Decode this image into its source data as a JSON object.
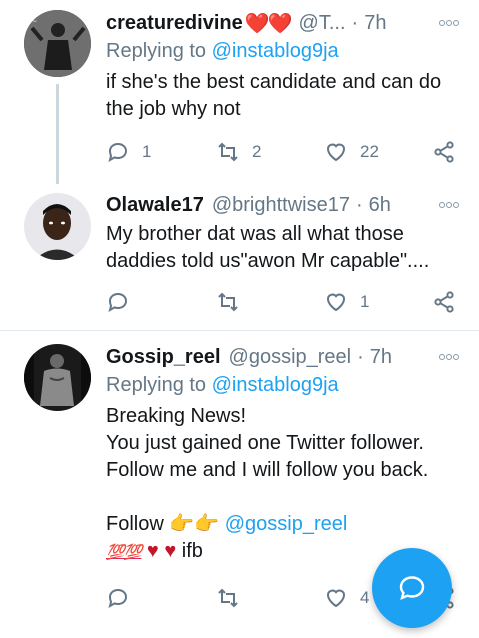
{
  "tweets": [
    {
      "name": "creaturedivine",
      "name_emoji": "❤️❤️",
      "handle": "@T...",
      "time": "7h",
      "replying_prefix": "Replying to",
      "replying_to": "@instablog9ja",
      "lines": [
        "if she's the best candidate and can do",
        "the job why not"
      ],
      "replies": "1",
      "retweets": "2",
      "likes": "22"
    },
    {
      "name": "Olawale17",
      "handle": "@brighttwise17",
      "time": "6h",
      "lines": [
        "My brother dat was all what those",
        "daddies told us\"awon Mr capable\"...."
      ],
      "replies": "",
      "retweets": "",
      "likes": "1"
    },
    {
      "name": "Gossip_reel",
      "handle": "@gossip_reel",
      "time": "7h",
      "replying_prefix": "Replying to",
      "replying_to": "@instablog9ja",
      "lines": [
        "Breaking News!",
        "You just gained one Twitter follower.",
        "Follow me and I will follow you back."
      ],
      "follow_word": "Follow",
      "follow_emoji": "👉👉",
      "follow_handle": "@gossip_reel",
      "last_emoji_100": "💯💯",
      "last_emoji_hearts": "♥ ♥",
      "last_word": "ifb",
      "replies": "",
      "retweets": "",
      "likes": "4"
    }
  ],
  "colors": {
    "accent": "#1da1f2",
    "secondary_text": "#657786",
    "like": "#e0245e"
  },
  "icons": [
    "reply-icon",
    "retweet-icon",
    "like-icon",
    "share-icon",
    "more-icon",
    "compose-tweet-icon"
  ]
}
